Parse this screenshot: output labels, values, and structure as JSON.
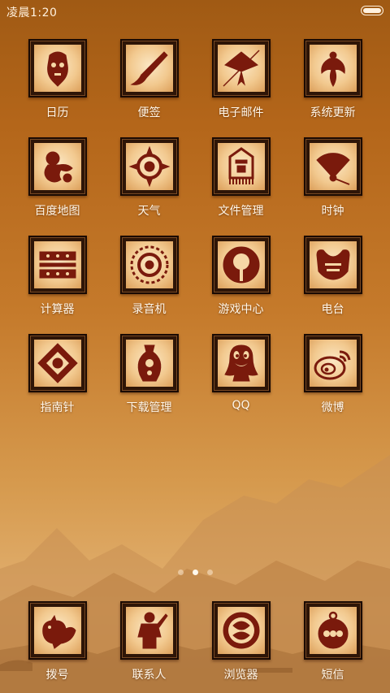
{
  "status_bar": {
    "time": "凌晨1:20"
  },
  "apps": [
    {
      "label": "日历",
      "icon": "opera-mask-icon"
    },
    {
      "label": "便签",
      "icon": "brush-icon"
    },
    {
      "label": "电子邮件",
      "icon": "kite-icon"
    },
    {
      "label": "系统更新",
      "icon": "phoenix-icon"
    },
    {
      "label": "百度地图",
      "icon": "monkey-icon"
    },
    {
      "label": "天气",
      "icon": "sun-medallion-icon"
    },
    {
      "label": "文件管理",
      "icon": "banner-icon"
    },
    {
      "label": "时钟",
      "icon": "fan-icon"
    },
    {
      "label": "计算器",
      "icon": "abacus-panels-icon"
    },
    {
      "label": "录音机",
      "icon": "round-papercut-icon"
    },
    {
      "label": "游戏中心",
      "icon": "ring-fan-icon"
    },
    {
      "label": "电台",
      "icon": "lock-pendant-icon"
    },
    {
      "label": "指南针",
      "icon": "diamond-papercut-icon"
    },
    {
      "label": "下载管理",
      "icon": "vase-icon"
    },
    {
      "label": "QQ",
      "icon": "penguin-icon"
    },
    {
      "label": "微博",
      "icon": "weibo-eye-icon"
    }
  ],
  "page_indicator": {
    "count": 3,
    "active": 2
  },
  "dock": [
    {
      "label": "拨号",
      "icon": "rooster-icon"
    },
    {
      "label": "联系人",
      "icon": "figure-icon"
    },
    {
      "label": "浏览器",
      "icon": "globe-medallion-icon"
    },
    {
      "label": "短信",
      "icon": "pendant-icon"
    }
  ],
  "colors": {
    "ink": "#7a1a0c",
    "frame": "#2e1507",
    "label": "#fff6e8"
  }
}
